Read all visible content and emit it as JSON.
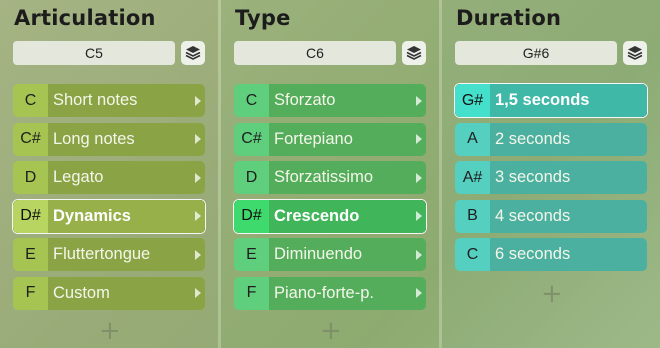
{
  "columns": [
    {
      "title": "Articulation",
      "picker_value": "C5",
      "items": [
        {
          "key": "C",
          "label": "Short notes"
        },
        {
          "key": "C#",
          "label": "Long notes"
        },
        {
          "key": "D",
          "label": "Legato"
        },
        {
          "key": "D#",
          "label": "Dynamics",
          "selected": true
        },
        {
          "key": "E",
          "label": "Fluttertongue"
        },
        {
          "key": "F",
          "label": "Custom"
        }
      ],
      "add_label": "+"
    },
    {
      "title": "Type",
      "picker_value": "C6",
      "items": [
        {
          "key": "C",
          "label": "Sforzato"
        },
        {
          "key": "C#",
          "label": "Fortepiano"
        },
        {
          "key": "D",
          "label": "Sforzatissimo"
        },
        {
          "key": "D#",
          "label": "Crescendo",
          "selected": true
        },
        {
          "key": "E",
          "label": "Diminuendo"
        },
        {
          "key": "F",
          "label": "Piano-forte-p."
        }
      ],
      "add_label": "+"
    },
    {
      "title": "Duration",
      "picker_value": "G#6",
      "items": [
        {
          "key": "G#",
          "label": "1,5 seconds",
          "selected": true
        },
        {
          "key": "A",
          "label": "2 seconds"
        },
        {
          "key": "A#",
          "label": "3 seconds"
        },
        {
          "key": "B",
          "label": "4 seconds"
        },
        {
          "key": "C",
          "label": "6 seconds"
        }
      ],
      "add_label": "+"
    }
  ],
  "icons": {
    "layers": "layers-icon",
    "arrow": "chevron-right-icon",
    "add": "plus-icon"
  },
  "colors": {
    "articulation_key": "#a6c452",
    "articulation_label": "#8aa344",
    "type_key": "#5fcf7d",
    "type_label": "#53ad5a",
    "duration_key": "#54cfc0",
    "duration_label": "#4bb0a0"
  }
}
